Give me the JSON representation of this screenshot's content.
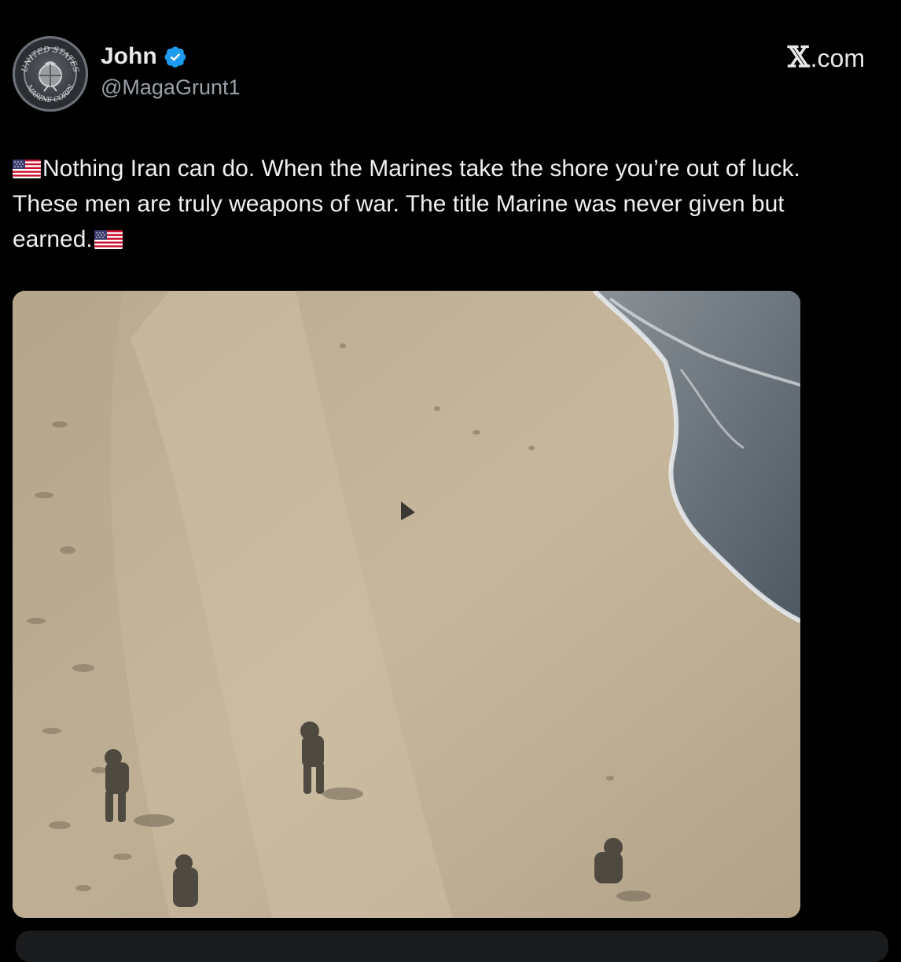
{
  "author": {
    "display_name": "John",
    "handle": "@MagaGrunt1",
    "verified": true,
    "avatar": {
      "icon": "usmc-emblem-icon",
      "top_text": "UNITED STATES",
      "bottom_text": "MARINE CORPS"
    }
  },
  "site": {
    "label": ".com",
    "logo_icon": "x-logo-icon",
    "logo_glyph": "𝕏"
  },
  "tweet": {
    "text_line": "Nothing Iran can do. When the Marines take the shore you’re out of luck. These men are truly weapons of war. The title Marine was never given but earned.",
    "flag_icon": "us-flag-icon"
  },
  "media": {
    "type": "video",
    "icon": "play-icon"
  },
  "colors": {
    "background": "#000000",
    "text": "#e7e9ea",
    "muted": "#9aa1a8",
    "verified": "#1d9bf0",
    "sand": "#c4b49a",
    "water": "#5c6873"
  }
}
